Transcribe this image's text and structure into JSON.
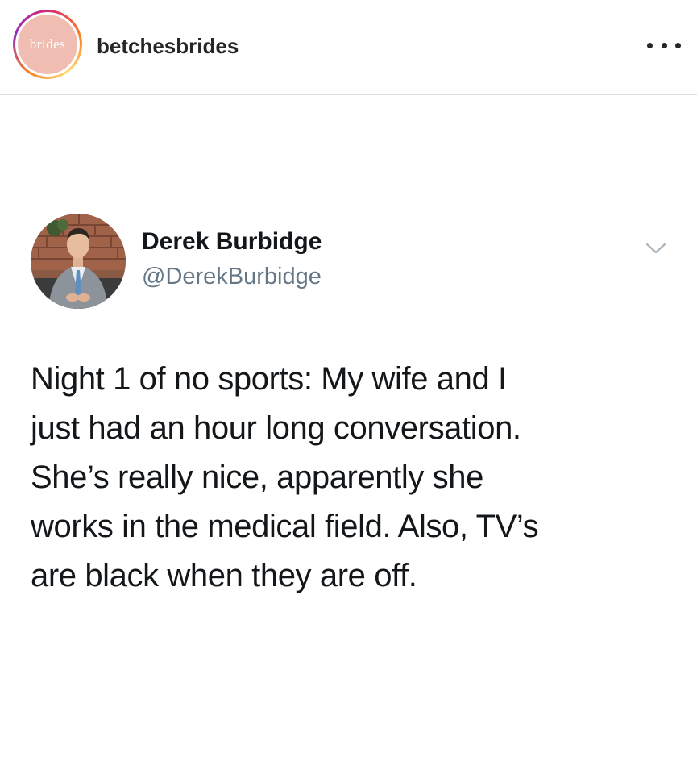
{
  "post_header": {
    "avatar_text": "brides",
    "username": "betchesbrides",
    "more_icon": "more-horizontal-icon"
  },
  "tweet": {
    "author_name": "Derek Burbidge",
    "author_handle": "@DerekBurbidge",
    "menu_icon": "chevron-down-icon",
    "text_lines": [
      "Night 1 of no sports: My wife and I",
      "just had an hour long conversation.",
      "She’s really nice, apparently she",
      "works in the medical field. Also, TV’s",
      "are black when they are off."
    ]
  },
  "colors": {
    "primary_text": "#14171a",
    "secondary_text": "#657786",
    "ig_username": "#262626",
    "divider": "#dbdbdb"
  }
}
